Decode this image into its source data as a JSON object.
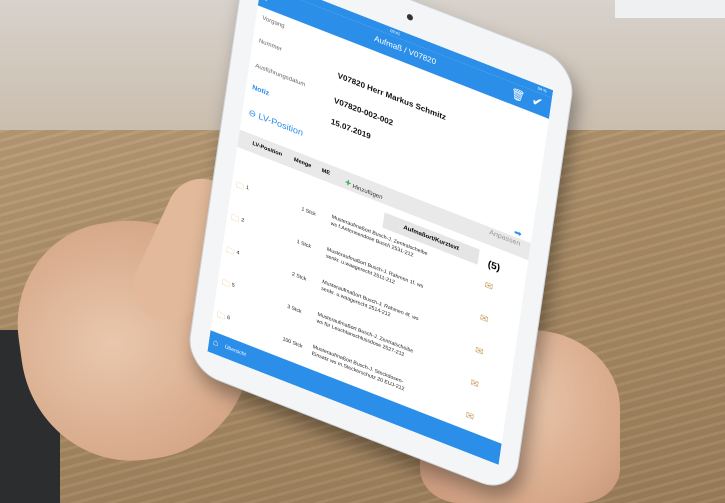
{
  "status": {
    "time": "09:41",
    "battery": "64 %"
  },
  "header": {
    "title": "Aufmaß / V07820"
  },
  "form": [
    {
      "label": "Vorgang",
      "value": ""
    },
    {
      "label": "Nummer",
      "value": "V07820 Herr Markus Schmitz"
    },
    {
      "label": "Ausführungsdatum",
      "value": "V07820-002-002"
    },
    {
      "label": "Notiz",
      "value": "15.07.2019"
    }
  ],
  "section": {
    "title": "LV-Position"
  },
  "grid": {
    "columns": [
      "LV-Position",
      "Menge",
      "ME"
    ],
    "add_label": "Hinzufügen",
    "adjust_label": "Anpassen",
    "count": "(5)",
    "text_header": "Aufmaßort/Kurztext",
    "rows": [
      {
        "nr": "1",
        "qty": "1 Stck",
        "text": "Musteraufmaßort Busch-J. Zentralscheibe ws f.Antennendose Busch 2531-212"
      },
      {
        "nr": "2",
        "qty": "1 Stck",
        "text": "Musteraufmaßort Busch-J. Rahmen 1f. ws senkr. u.waagerecht 2511-212"
      },
      {
        "nr": "4",
        "qty": "2 Stck",
        "text": "Musteraufmaßort Busch-J. Rahmen 4f. ws senkr. u.waagerecht 2514-212"
      },
      {
        "nr": "5",
        "qty": "3 Stck",
        "text": "Musteraufmaßort Busch-J. Zentralscheibe ws für Leuchtanschlussdose 2527-212"
      },
      {
        "nr": "6",
        "qty": "100 Stck",
        "text": "Musteraufmaßort Busch-J. Steckdosen-Einsatz ws m.Steckerschutz 20 EUJ-212"
      }
    ]
  },
  "footer": {
    "label": "Übersicht"
  }
}
